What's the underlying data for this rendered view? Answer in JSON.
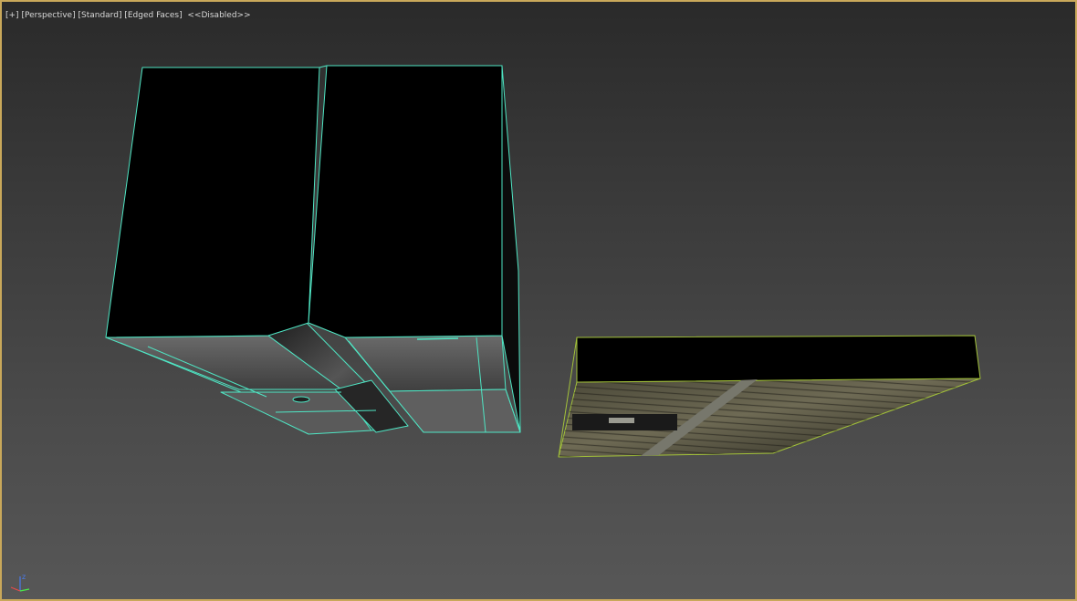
{
  "viewport": {
    "menu_label": "[+]",
    "view_label": "[Perspective]",
    "shading_label": "[Standard]",
    "edge_mode_label": "[Edged Faces]",
    "status_label": "<<Disabled>>"
  },
  "gizmo": {
    "axis_z": "z"
  },
  "colors": {
    "frame_border": "#c9a85a",
    "selection_wire": "#4fe6c4",
    "object_wire": "#a3c23a"
  }
}
